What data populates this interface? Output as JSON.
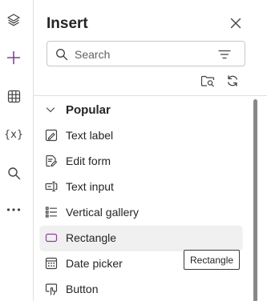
{
  "rail": {
    "items": [
      {
        "name": "tree-view",
        "icon": "layers-icon"
      },
      {
        "name": "insert",
        "icon": "plus-icon",
        "active_color": "#8a3f9a"
      },
      {
        "name": "data",
        "icon": "table-icon"
      },
      {
        "name": "variables",
        "icon": "variables-icon",
        "glyph": "{x}"
      },
      {
        "name": "search",
        "icon": "search-icon"
      },
      {
        "name": "more",
        "icon": "more-icon"
      }
    ]
  },
  "panel": {
    "title": "Insert",
    "search": {
      "placeholder": "Search",
      "value": ""
    },
    "category": {
      "label": "Popular",
      "expanded": true
    },
    "items": [
      {
        "label": "Text label",
        "icon": "text-label-icon"
      },
      {
        "label": "Edit form",
        "icon": "edit-form-icon"
      },
      {
        "label": "Text input",
        "icon": "text-input-icon"
      },
      {
        "label": "Vertical gallery",
        "icon": "vertical-gallery-icon"
      },
      {
        "label": "Rectangle",
        "icon": "rectangle-icon",
        "hovered": true
      },
      {
        "label": "Date picker",
        "icon": "date-picker-icon"
      },
      {
        "label": "Button",
        "icon": "button-icon"
      }
    ],
    "tooltip": "Rectangle"
  },
  "colors": {
    "accent": "#8a3f9a",
    "icon": "#424242",
    "border": "#e1dfdd",
    "hover_bg": "#f0f0f0"
  }
}
